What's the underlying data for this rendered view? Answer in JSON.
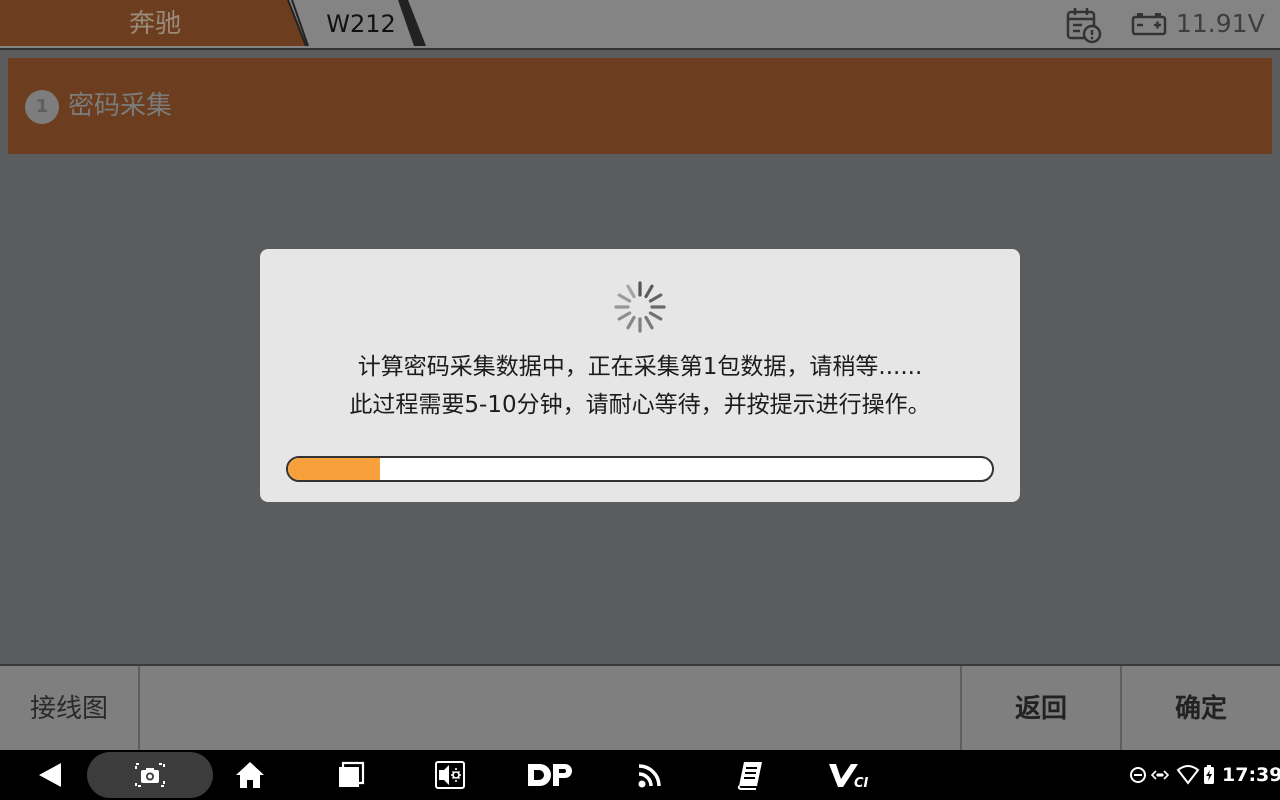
{
  "topbar": {
    "breadcrumb_brand": "奔驰",
    "breadcrumb_model": "W212",
    "voltage": "11.91V"
  },
  "step": {
    "number": "1",
    "label": "密码采集"
  },
  "dialog": {
    "line1": "计算密码采集数据中，正在采集第1包数据，请稍等......",
    "line2": "此过程需要5-10分钟，请耐心等待，并按提示进行操作。",
    "progress_fraction": 0.13
  },
  "toolbar": {
    "wiring_label": "接线图",
    "back_label": "返回",
    "ok_label": "确定"
  },
  "navbar": {
    "time": "17:39",
    "icons": [
      "back-icon",
      "screenshot-icon",
      "home-icon",
      "recents-icon",
      "brightness-icon",
      "dp-icon",
      "rss-icon",
      "manual-icon",
      "vci-icon",
      "dnd-icon",
      "data-icon",
      "wifi-icon",
      "battery-charging-icon"
    ]
  },
  "colors": {
    "brand_crumb": "#6c3e1f",
    "step_header": "#6c3e1f",
    "progress_fill": "#f7a03c"
  }
}
